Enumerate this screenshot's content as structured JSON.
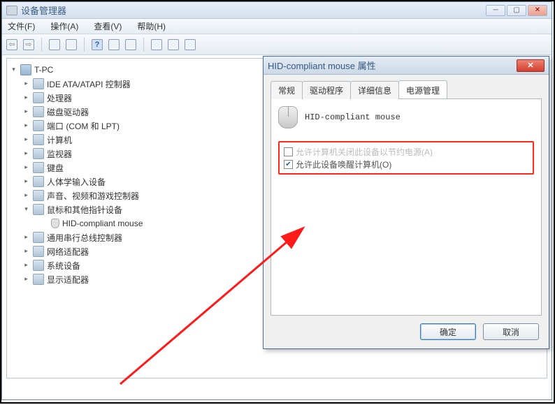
{
  "mainWindow": {
    "title": "设备管理器",
    "menus": {
      "file": "文件(F)",
      "action": "操作(A)",
      "view": "查看(V)",
      "help": "帮助(H)"
    }
  },
  "tree": {
    "root": "T-PC",
    "items": [
      {
        "label": "IDE ATA/ATAPI 控制器"
      },
      {
        "label": "处理器"
      },
      {
        "label": "磁盘驱动器"
      },
      {
        "label": "端口 (COM 和 LPT)"
      },
      {
        "label": "计算机"
      },
      {
        "label": "监视器"
      },
      {
        "label": "键盘"
      },
      {
        "label": "人体学输入设备"
      },
      {
        "label": "声音、视频和游戏控制器"
      },
      {
        "label": "鼠标和其他指针设备",
        "expanded": true,
        "children": [
          {
            "label": "HID-compliant mouse"
          }
        ]
      },
      {
        "label": "通用串行总线控制器"
      },
      {
        "label": "网络适配器"
      },
      {
        "label": "系统设备"
      },
      {
        "label": "显示适配器"
      }
    ]
  },
  "dialog": {
    "title": "HID-compliant mouse 属性",
    "tabs": {
      "general": "常规",
      "driver": "驱动程序",
      "details": "详细信息",
      "power": "电源管理"
    },
    "deviceName": "HID-compliant mouse",
    "opt1": "允许计算机关闭此设备以节约电源(A)",
    "opt2": "允许此设备唤醒计算机(O)",
    "ok": "确定",
    "cancel": "取消"
  }
}
